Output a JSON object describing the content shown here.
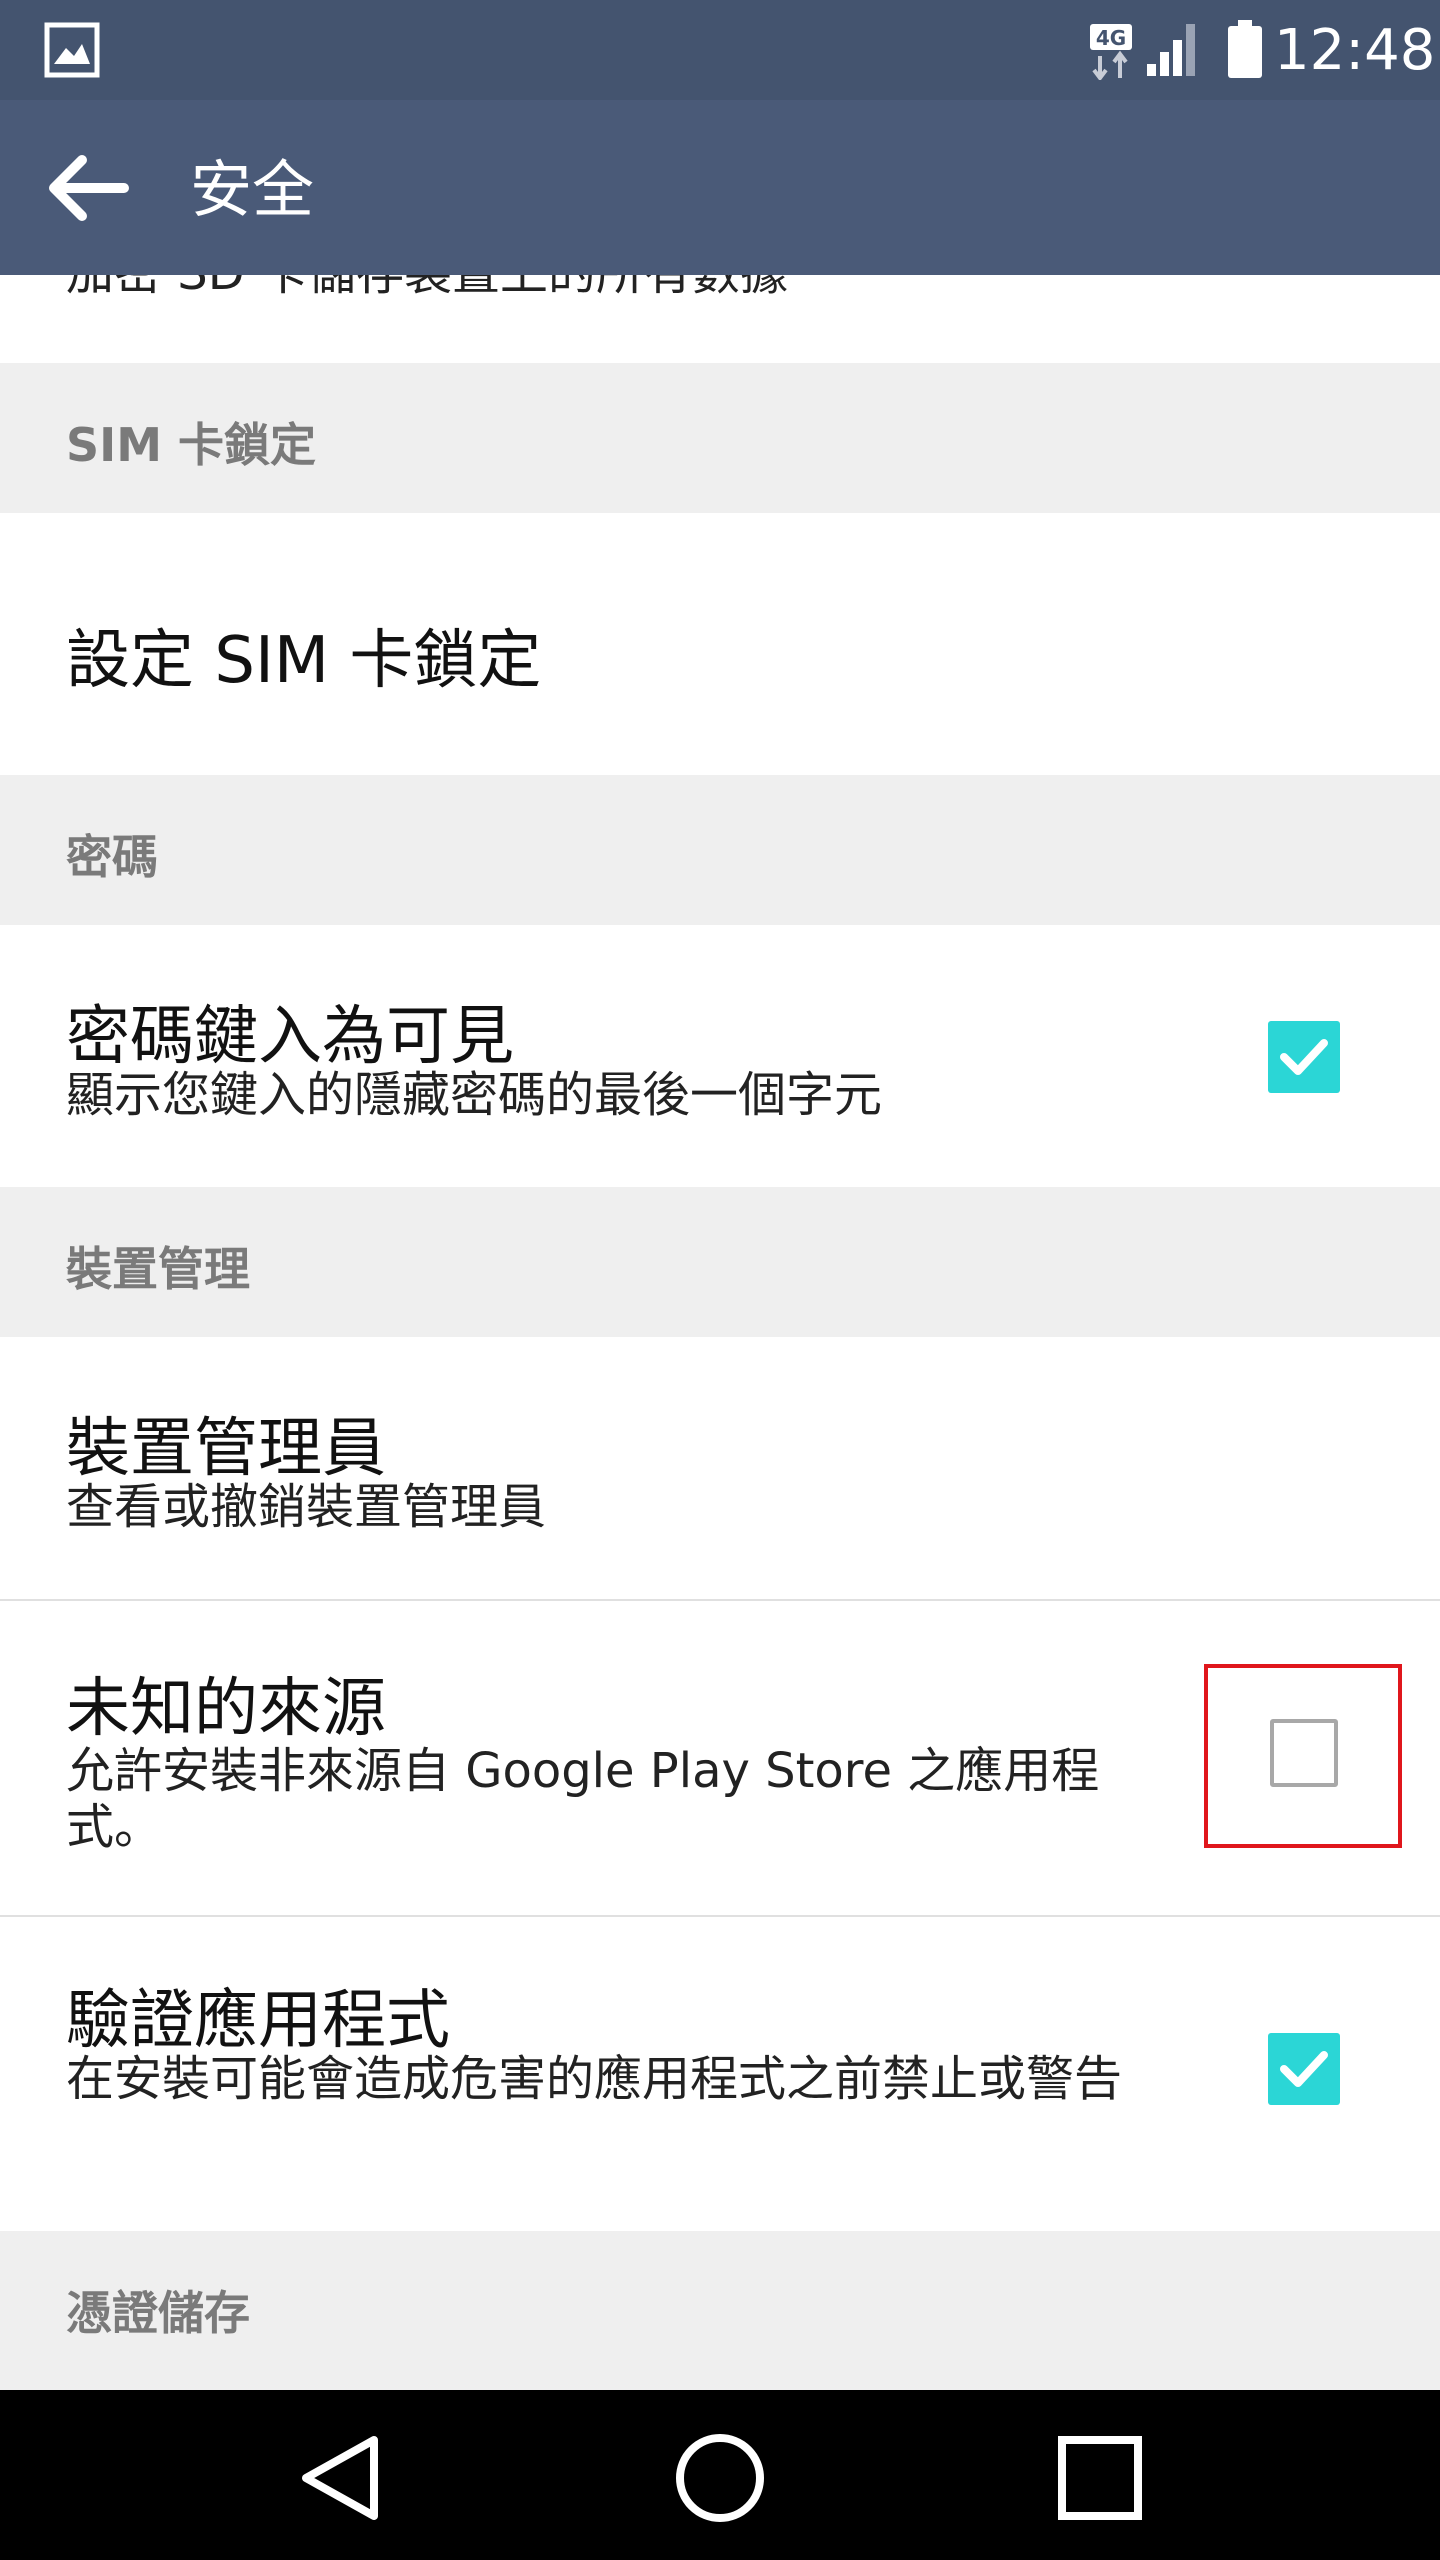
{
  "status_bar": {
    "time": "12:48",
    "network_type": "4G",
    "icons": [
      "image-icon",
      "network-4g-icon",
      "signal-icon",
      "battery-icon"
    ]
  },
  "app_bar": {
    "title": "安全",
    "back_icon": "back-arrow-icon"
  },
  "partial_top_text": "加密 SD 卡儲存裝置上的所有數據",
  "sections": {
    "sim": {
      "header": "SIM 卡鎖定",
      "item_title": "設定 SIM 卡鎖定"
    },
    "password": {
      "header": "密碼",
      "item_title": "密碼鍵入為可見",
      "item_sub": "顯示您鍵入的隱藏密碼的最後一個字元",
      "checked": true
    },
    "device_admin": {
      "header": "裝置管理",
      "admin_title": "裝置管理員",
      "admin_sub": "查看或撤銷裝置管理員",
      "unknown_title": "未知的來源",
      "unknown_sub": "允許安裝非來源自 Google Play Store 之應用程式。",
      "unknown_checked": false,
      "verify_title": "驗證應用程式",
      "verify_sub": "在安裝可能會造成危害的應用程式之前禁止或警告",
      "verify_checked": true
    },
    "credentials": {
      "header": "憑證儲存"
    }
  },
  "colors": {
    "status_bar": "#44546f",
    "app_bar": "#4a5a78",
    "checkbox_checked": "#2bd6d6",
    "highlight": "#e0161c",
    "section_header_bg": "#efefef"
  },
  "nav_bar": {
    "icons": [
      "back-triangle-icon",
      "home-circle-icon",
      "recents-square-icon"
    ]
  }
}
